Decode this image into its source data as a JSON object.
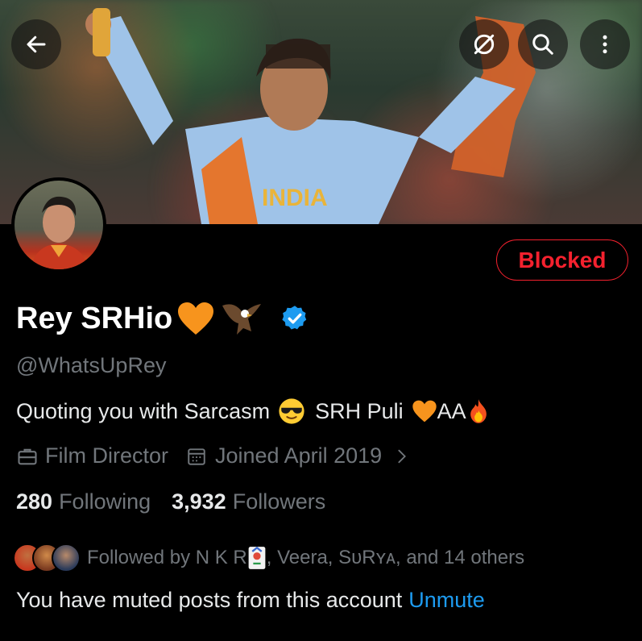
{
  "header": {
    "back_icon": "arrow-left-icon",
    "menu_icons": [
      "no-sync-icon",
      "search-icon",
      "more-vertical-icon"
    ]
  },
  "profile": {
    "blocked_label": "Blocked",
    "display_name": "Rey SRHio",
    "name_emojis": [
      "orange-heart",
      "eagle"
    ],
    "verified": true,
    "handle": "@WhatsUpRey",
    "bio_text_1": "Quoting you with Sarcasm",
    "bio_text_2": "SRH Puli",
    "bio_text_3": "AA",
    "profession": "Film Director",
    "joined": "Joined April 2019",
    "following_count": "280",
    "following_label": "Following",
    "followers_count": "3,932",
    "followers_label": "Followers",
    "followed_by_prefix": "Followed by N K R",
    "followed_by_suffix": ", Veera, SᴜRʏᴀ, and 14 others",
    "muted_text": "You have muted posts from this account",
    "unmute_label": "Unmute"
  },
  "colors": {
    "blocked": "#f4212e",
    "link": "#1d9bf0",
    "secondary_text": "#71767b",
    "verified": "#1d9bf0"
  }
}
